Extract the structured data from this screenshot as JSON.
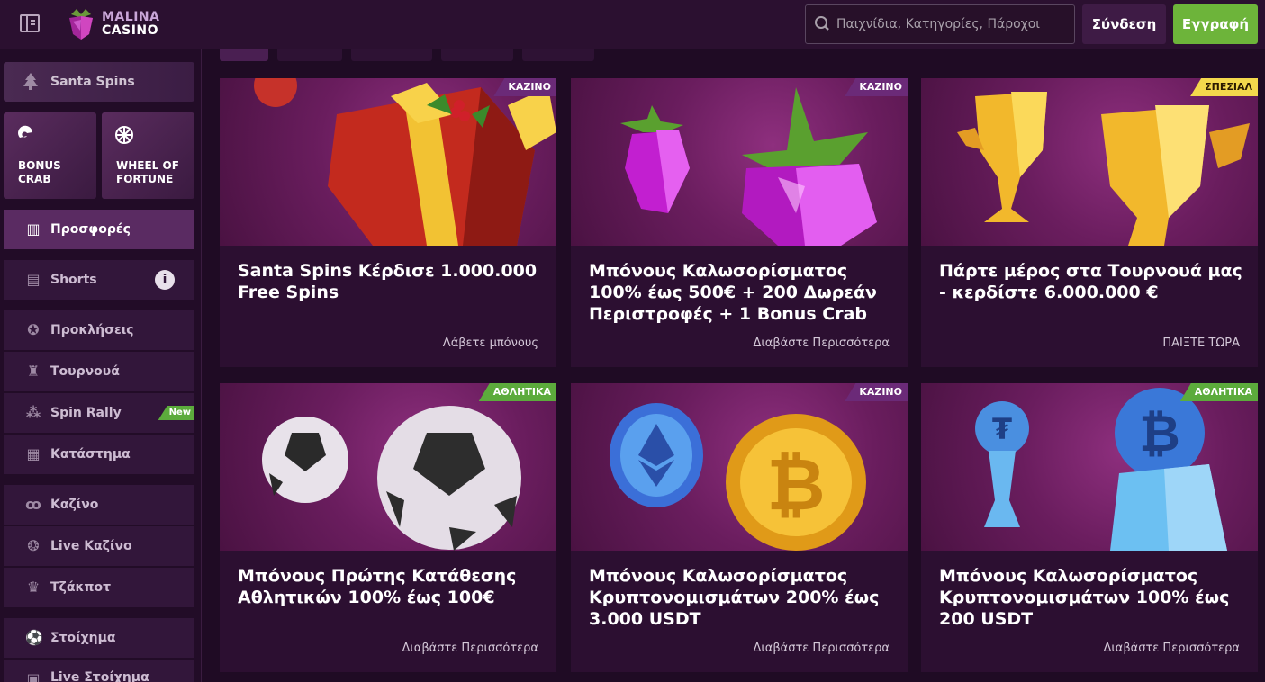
{
  "header": {
    "logo_line1": "MALINA",
    "logo_line2": "CASINO",
    "search_placeholder": "Παιχνίδια, Κατηγορίες, Πάροχοι",
    "login_label": "Σύνδεση",
    "register_label": "Εγγραφή"
  },
  "sidebar": {
    "santa": "Santa Spins",
    "tiles": [
      {
        "line1": "BONUS",
        "line2": "CRAB",
        "icon": "crab-icon"
      },
      {
        "line1": "WHEEL OF",
        "line2": "FORTUNE",
        "icon": "wheel-icon"
      }
    ],
    "items": [
      {
        "label": "Προσφορές",
        "icon": "gift-icon",
        "active": true
      },
      {
        "label": "Shorts",
        "icon": "film-icon"
      },
      {
        "label": "Προκλήσεις",
        "icon": "medal-icon"
      },
      {
        "label": "Τουρνουά",
        "icon": "trophy-icon"
      },
      {
        "label": "Spin Rally",
        "icon": "rally-icon",
        "badge": "New"
      },
      {
        "label": "Κατάστημα",
        "icon": "store-icon"
      },
      {
        "label": "Καζίνο",
        "icon": "cherries-icon"
      },
      {
        "label": "Live Καζίνο",
        "icon": "chip-icon"
      },
      {
        "label": "Τζάκποτ",
        "icon": "jackpot-icon"
      },
      {
        "label": "Στοίχημα",
        "icon": "football-icon"
      },
      {
        "label": "Live Στοίχημα",
        "icon": "live-icon"
      }
    ]
  },
  "cards": [
    {
      "badge": "ΚΑΖΙΝΟ",
      "badge_type": "casino",
      "title": "Santa Spins Κέρδισε 1.000.000 Free Spins",
      "link": "Λάβετε μπόνους",
      "art": "gift"
    },
    {
      "badge": "ΚΑΖΙΝΟ",
      "badge_type": "casino",
      "title": "Μπόνους Καλωσορίσματος 100% έως 500€ + 200 Δωρεάν Περιστροφές + 1 Bonus Crab",
      "link": "Διαβάστε Περισσότερα",
      "art": "raspberry"
    },
    {
      "badge": "ΣΠΕΣΙΑΛ",
      "badge_type": "special",
      "title": "Πάρτε μέρος στα Τουρνουά μας - κερδίστε 6.000.000 €",
      "link": "ΠΑΙΞΤΕ ΤΩΡΑ",
      "art": "trophy"
    },
    {
      "badge": "ΑΘΛΗΤΙΚΑ",
      "badge_type": "sports",
      "title": "Μπόνους Πρώτης Κατάθεσης Αθλητικών 100% έως 100€",
      "link": "Διαβάστε Περισσότερα",
      "art": "football"
    },
    {
      "badge": "ΚΑΖΙΝΟ",
      "badge_type": "casino",
      "title": "Μπόνους Καλωσορίσματος Κρυπτονομισμάτων 200% έως 3.000 USDT",
      "link": "Διαβάστε Περισσότερα",
      "art": "coins"
    },
    {
      "badge": "ΑΘΛΗΤΙΚΑ",
      "badge_type": "sports",
      "title": "Μπόνους Καλωσορίσματος Κρυπτονομισμάτων 100% έως 200 USDT",
      "link": "Διαβάστε Περισσότερα",
      "art": "crypto-trophy"
    }
  ]
}
